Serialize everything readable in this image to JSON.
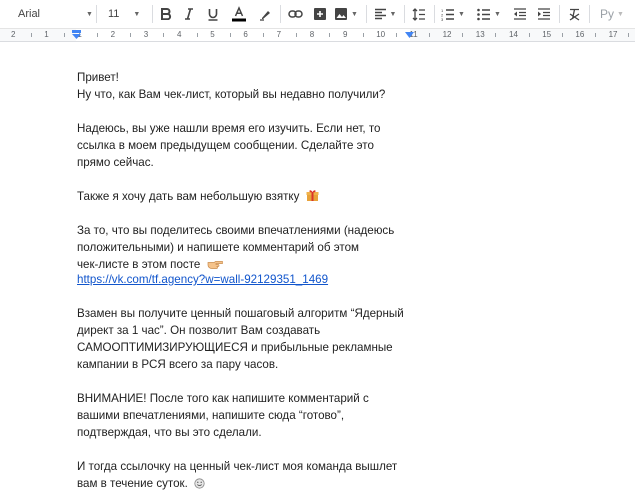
{
  "toolbar": {
    "font_name": "Arial",
    "font_size": "11",
    "input_tools_label": "Ру",
    "icons": [
      "bold-icon",
      "italic-icon",
      "underline-icon",
      "text-color-icon",
      "highlight-icon",
      "link-icon",
      "insert-comment-icon",
      "insert-image-icon",
      "align-left-icon",
      "line-spacing-icon",
      "numbered-list-icon",
      "bulleted-list-icon",
      "decrease-indent-icon",
      "increase-indent-icon",
      "clear-formatting-icon",
      "input-tools-icon"
    ],
    "colors": {
      "accent_text": "#000000",
      "link": "#1155cc",
      "ruler_marker": "#4285f4"
    }
  },
  "ruler": {
    "numbers": [
      "2",
      "1",
      "1",
      "2",
      "3",
      "4",
      "5",
      "6",
      "7",
      "8",
      "9",
      "10",
      "11",
      "12",
      "13",
      "14",
      "15",
      "16",
      "17",
      "18"
    ]
  },
  "document": {
    "p1": {
      "line1": "Привет!",
      "line2": "Ну что, как Вам чек-лист, который вы недавно получили?"
    },
    "p2": {
      "line1": "Надеюсь, вы уже нашли время его изучить. Если нет, то",
      "line2": "ссылка в моем предыдущем сообщении. Сделайте это",
      "line3": "прямо сейчас."
    },
    "p3": {
      "line1": "Также я хочу дать вам небольшую взятку",
      "emoji": "gift-icon"
    },
    "p4": {
      "line1": "За то, что вы поделитесь своими впечатлениями (надеюсь",
      "line2": "положительными) и напишете комментарий об этом",
      "line3": "чек-листе в этом посте",
      "emoji": "pointing-hand-icon",
      "link": "https://vk.com/tf.agency?w=wall-92129351_1469"
    },
    "p5": {
      "line1": "Взамен вы получите ценный пошаговый алгоритм “Ядерный",
      "line2": "директ за 1 час”. Он позволит Вам создавать",
      "line3": "САМООПТИМИЗИРУЮЩИЕСЯ и прибыльные рекламные",
      "line4": "кампании в РСЯ всего за пару часов."
    },
    "p6": {
      "line1": "ВНИМАНИЕ! После того как напишите комментарий с",
      "line2": "вашими впечатлениями, напишите сюда “готово”,",
      "line3": "подтверждая, что вы это сделали."
    },
    "p7": {
      "line1": "И тогда ссылочку на ценный чек-лист моя команда вышлет",
      "line2": "вам в течение суток.",
      "emoji": "smile-icon"
    }
  }
}
